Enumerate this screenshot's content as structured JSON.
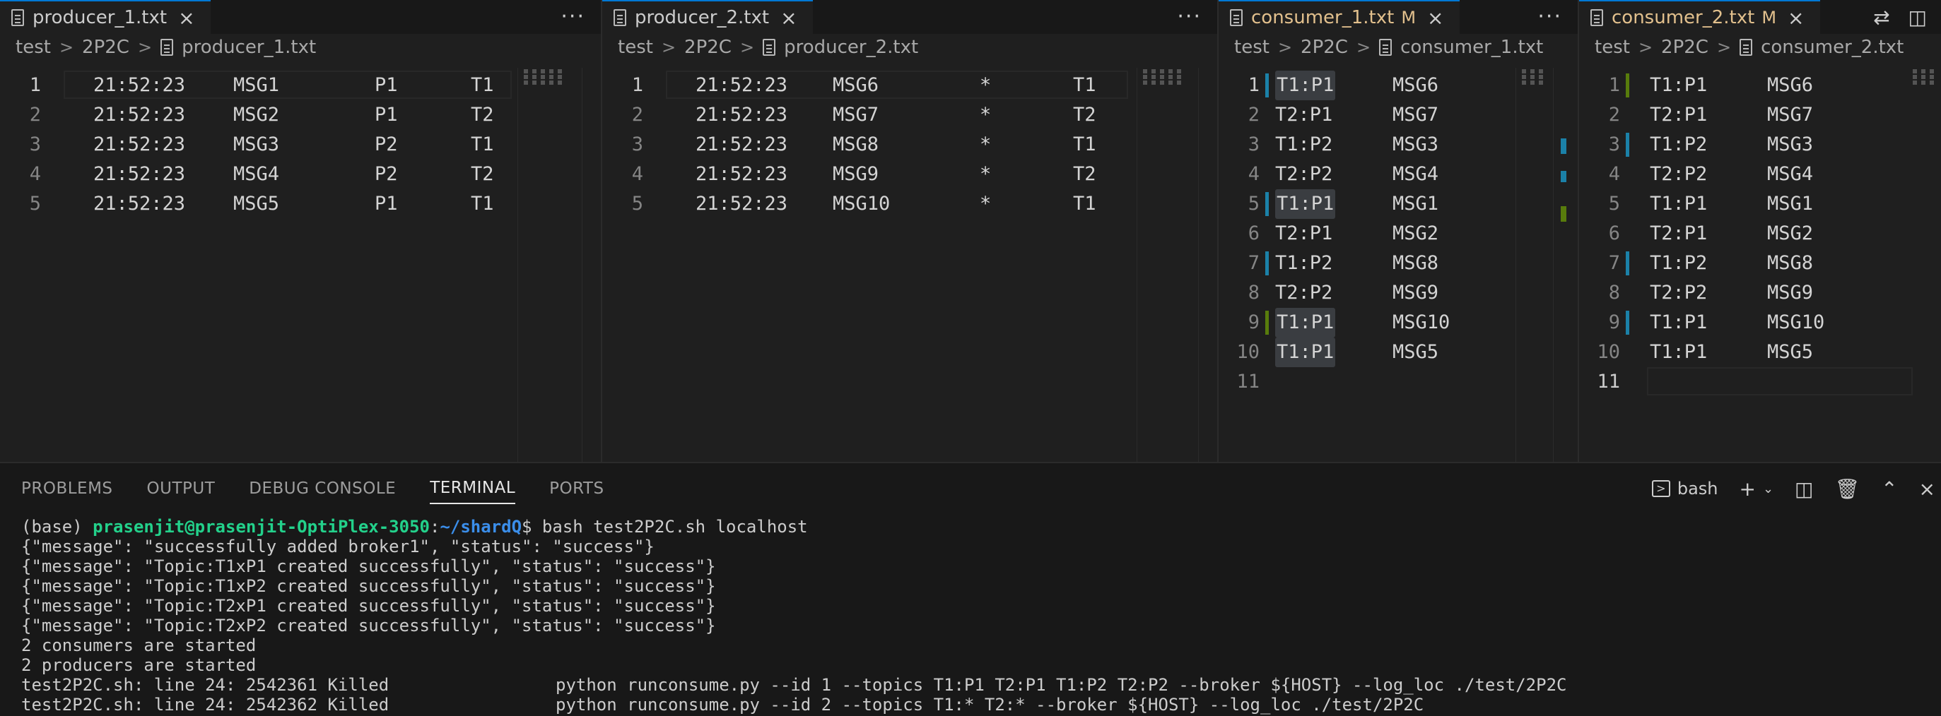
{
  "editors": [
    {
      "tab": {
        "label": "producer_1.txt",
        "modified": false
      },
      "breadcrumb": [
        "test",
        "2P2C",
        "producer_1.txt"
      ],
      "lines": [
        [
          "21:52:23",
          "MSG1",
          "P1",
          "T1"
        ],
        [
          "21:52:23",
          "MSG2",
          "P1",
          "T2"
        ],
        [
          "21:52:23",
          "MSG3",
          "P2",
          "T1"
        ],
        [
          "21:52:23",
          "MSG4",
          "P2",
          "T2"
        ],
        [
          "21:52:23",
          "MSG5",
          "P1",
          "T1"
        ]
      ]
    },
    {
      "tab": {
        "label": "producer_2.txt",
        "modified": false
      },
      "breadcrumb": [
        "test",
        "2P2C",
        "producer_2.txt"
      ],
      "lines": [
        [
          "21:52:23",
          "MSG6",
          "*",
          "T1"
        ],
        [
          "21:52:23",
          "MSG7",
          "*",
          "T2"
        ],
        [
          "21:52:23",
          "MSG8",
          "*",
          "T1"
        ],
        [
          "21:52:23",
          "MSG9",
          "*",
          "T2"
        ],
        [
          "21:52:23",
          "MSG10",
          "*",
          "T1"
        ]
      ]
    },
    {
      "tab": {
        "label": "consumer_1.txt",
        "modified": true,
        "modified_flag": "M"
      },
      "breadcrumb": [
        "test",
        "2P2C",
        "consumer_1.txt"
      ],
      "lines": [
        [
          "T1:P1",
          "MSG6"
        ],
        [
          "T2:P1",
          "MSG7"
        ],
        [
          "T1:P2",
          "MSG3"
        ],
        [
          "T2:P2",
          "MSG4"
        ],
        [
          "T1:P1",
          "MSG1"
        ],
        [
          "T2:P1",
          "MSG2"
        ],
        [
          "T1:P2",
          "MSG8"
        ],
        [
          "T2:P2",
          "MSG9"
        ],
        [
          "T1:P1",
          "MSG10"
        ],
        [
          "T1:P1",
          "MSG5"
        ],
        [
          "",
          ""
        ]
      ]
    },
    {
      "tab": {
        "label": "consumer_2.txt",
        "modified": true,
        "modified_flag": "M"
      },
      "breadcrumb": [
        "test",
        "2P2C",
        "consumer_2.txt"
      ],
      "lines": [
        [
          "T1:P1",
          "MSG6"
        ],
        [
          "T2:P1",
          "MSG7"
        ],
        [
          "T1:P2",
          "MSG3"
        ],
        [
          "T2:P2",
          "MSG4"
        ],
        [
          "T1:P1",
          "MSG1"
        ],
        [
          "T2:P1",
          "MSG2"
        ],
        [
          "T1:P2",
          "MSG8"
        ],
        [
          "T2:P2",
          "MSG9"
        ],
        [
          "T1:P1",
          "MSG10"
        ],
        [
          "T1:P1",
          "MSG5"
        ],
        [
          "",
          ""
        ]
      ]
    }
  ],
  "more_label": "···",
  "panel": {
    "tabs": [
      "PROBLEMS",
      "OUTPUT",
      "DEBUG CONSOLE",
      "TERMINAL",
      "PORTS"
    ],
    "active_tab": "TERMINAL",
    "shell_label": "bash"
  },
  "terminal": {
    "prompt_env": "(base) ",
    "prompt_user": "prasenjit@prasenjit-OptiPlex-3050",
    "prompt_sep": ":",
    "prompt_path": "~/shardQ",
    "prompt_cmd": "$ bash test2P2C.sh localhost",
    "lines": [
      "{\"message\": \"successfully added broker1\", \"status\": \"success\"}",
      "{\"message\": \"Topic:T1xP1 created successfully\", \"status\": \"success\"}",
      "{\"message\": \"Topic:T1xP2 created successfully\", \"status\": \"success\"}",
      "{\"message\": \"Topic:T2xP1 created successfully\", \"status\": \"success\"}",
      "{\"message\": \"Topic:T2xP2 created successfully\", \"status\": \"success\"}",
      "2 consumers are started",
      "2 producers are started"
    ],
    "killed": [
      {
        "left": "test2P2C.sh: line 24: 2542361 Killed",
        "right": "python runconsume.py --id 1 --topics T1:P1 T2:P1 T1:P2 T2:P2 --broker ${HOST} --log_loc ./test/2P2C"
      },
      {
        "left": "test2P2C.sh: line 24: 2542362 Killed",
        "right": "python runconsume.py --id 2 --topics T1:* T2:* --broker ${HOST} --log_loc ./test/2P2C"
      }
    ]
  }
}
